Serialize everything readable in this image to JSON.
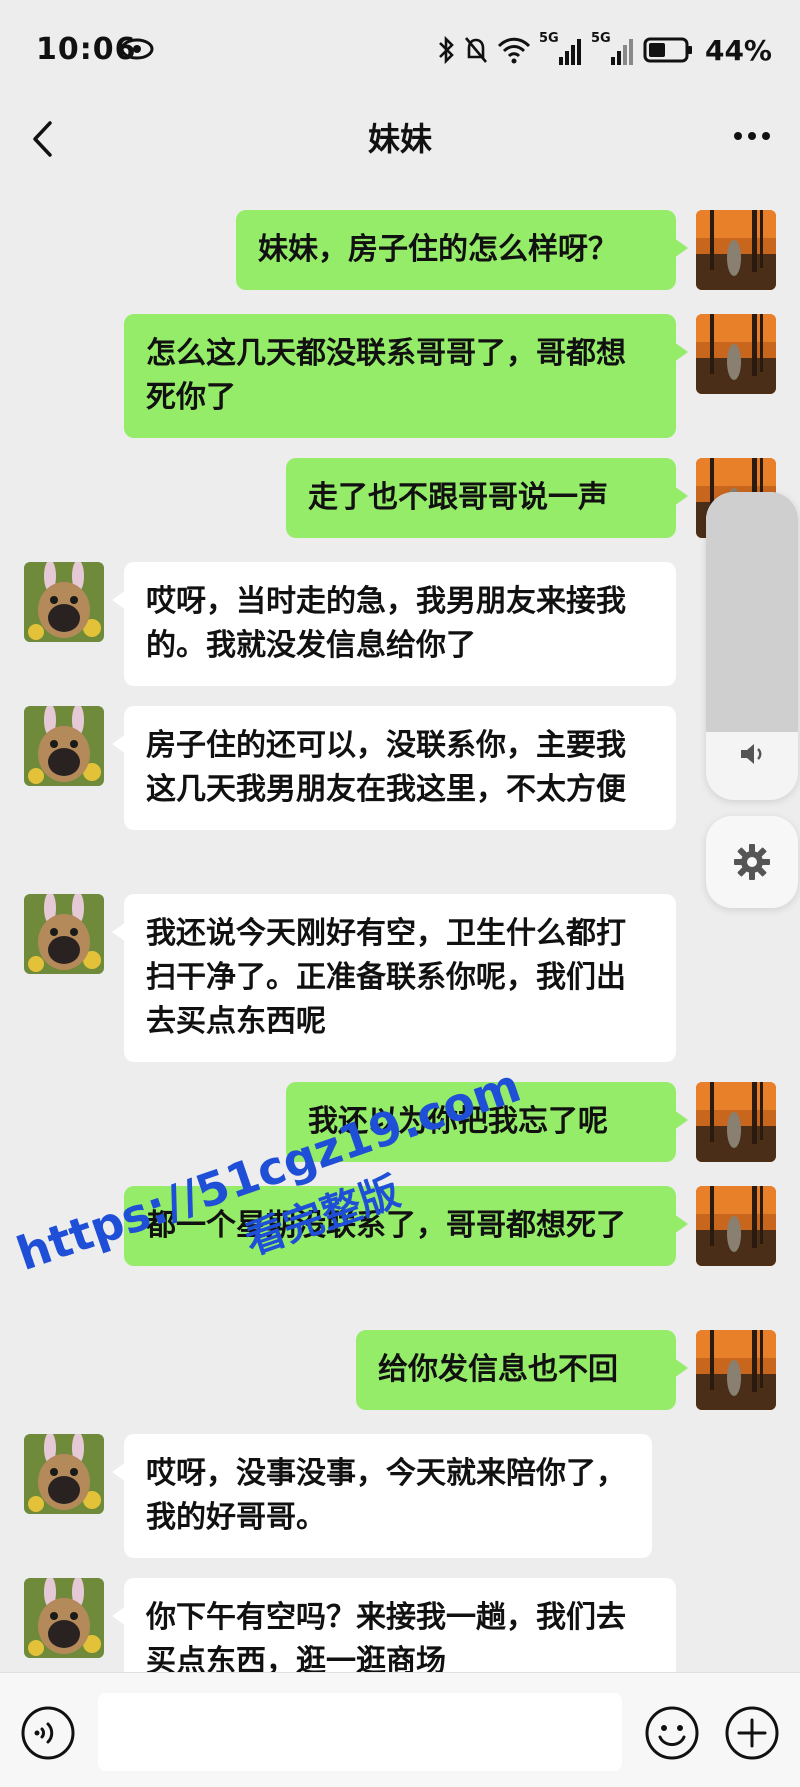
{
  "status_bar": {
    "time": "10:06",
    "network_1": "5G",
    "network_2": "5G",
    "battery_percent": "44%"
  },
  "header": {
    "title": "妹妹"
  },
  "messages": [
    {
      "sender": "me",
      "text": "妹妹，房子住的怎么样呀？"
    },
    {
      "sender": "me",
      "text": "怎么这几天都没联系哥哥了，哥都想死你了"
    },
    {
      "sender": "me",
      "text": "走了也不跟哥哥说一声"
    },
    {
      "sender": "her",
      "text": "哎呀，当时走的急，我男朋友来接我的。我就没发信息给你了"
    },
    {
      "sender": "her",
      "text": "房子住的还可以，没联系你，主要我这几天我男朋友在我这里，不太方便"
    },
    {
      "sender": "her",
      "text": "我还说今天刚好有空，卫生什么都打扫干净了。正准备联系你呢，我们出去买点东西呢"
    },
    {
      "sender": "me",
      "text": "我还以为你把我忘了呢"
    },
    {
      "sender": "me",
      "text": "都一个星期没联系了，哥哥都想死了"
    },
    {
      "sender": "me",
      "text": "给你发信息也不回"
    },
    {
      "sender": "her",
      "text": "哎呀，没事没事，今天就来陪你了，我的好哥哥。"
    },
    {
      "sender": "her",
      "text": "你下午有空吗？来接我一趟，我们去买点东西，逛一逛商场"
    }
  ],
  "watermark": {
    "line1": "https://51cgz19.com",
    "line2": "看完整版"
  },
  "volume_panel": {
    "level_fraction": 0.78
  },
  "icons": {
    "back": "chevron-left-icon",
    "more": "more-dots-icon",
    "voice": "voice-icon",
    "emoji": "emoji-icon",
    "plus": "plus-icon",
    "settings": "gear-icon",
    "speaker": "speaker-icon"
  },
  "colors": {
    "my_bubble": "#95ec69",
    "her_bubble": "#ffffff",
    "background": "#ededed",
    "watermark": "#1f4fd6"
  }
}
